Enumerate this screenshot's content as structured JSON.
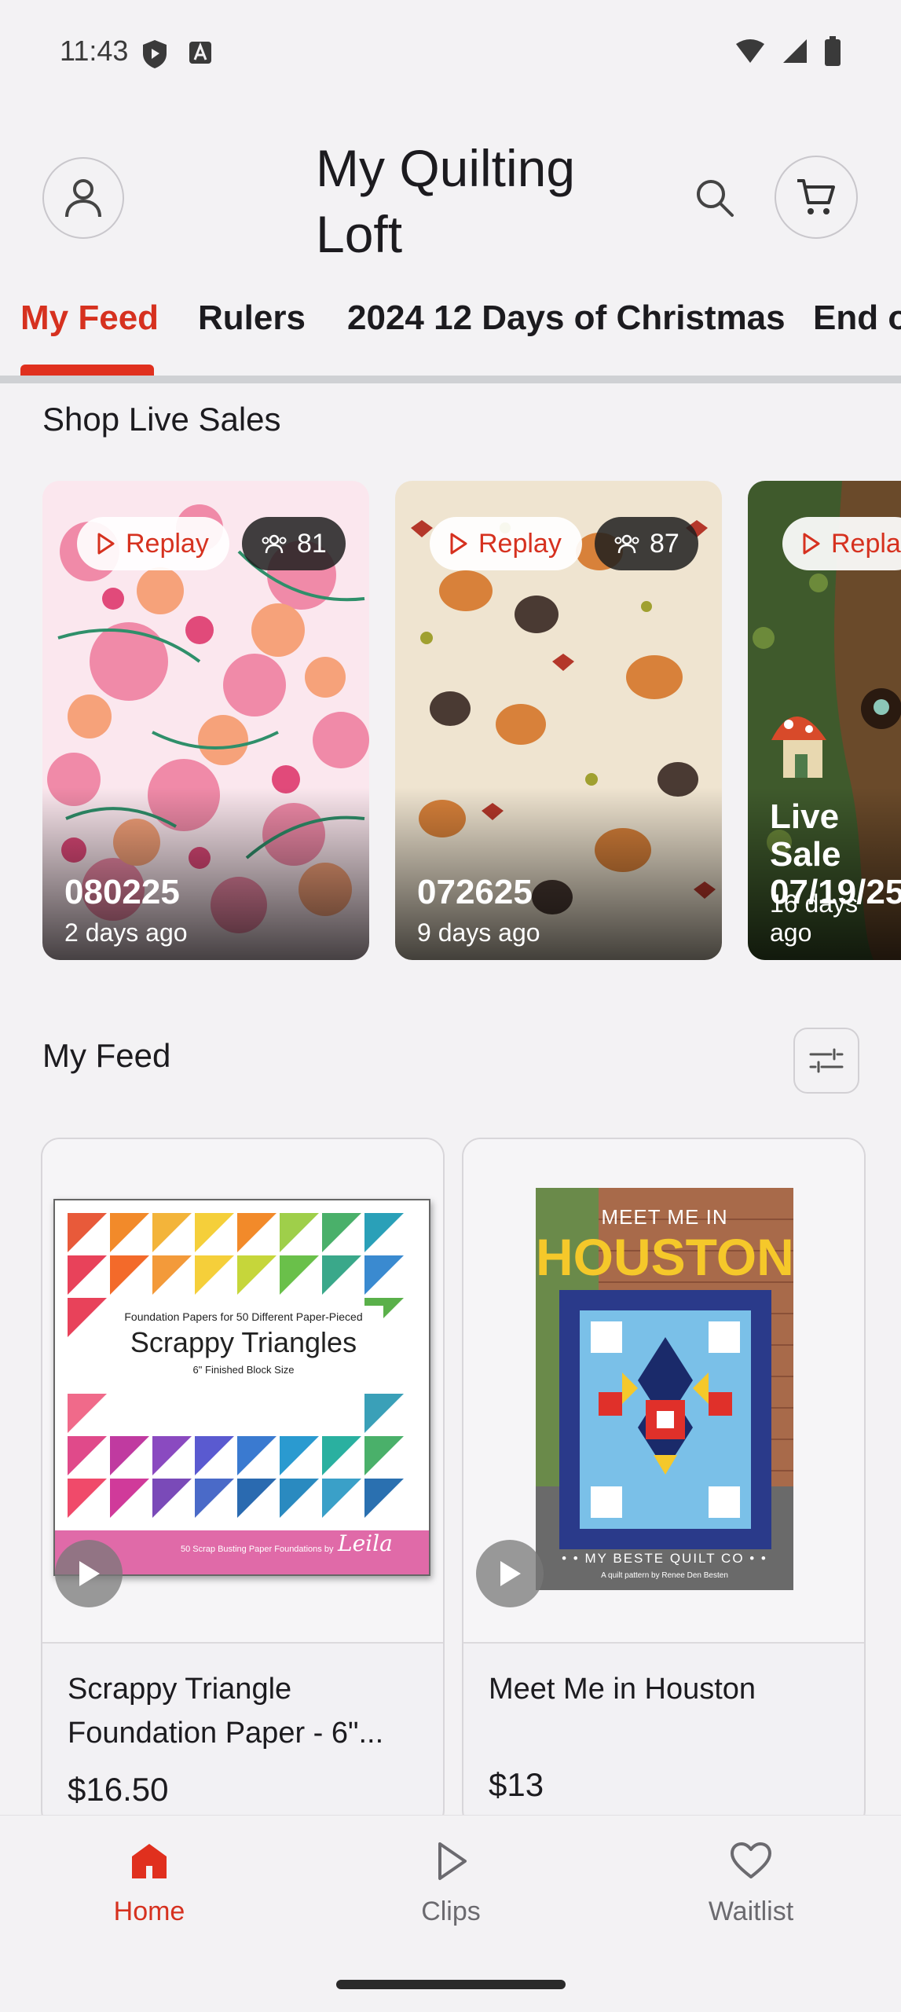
{
  "status_bar": {
    "time": "11:43"
  },
  "header": {
    "title": "My Quilting Loft"
  },
  "tabs": [
    {
      "label": "My Feed",
      "active": true
    },
    {
      "label": "Rulers",
      "active": false
    },
    {
      "label": "2024 12 Days of Christmas",
      "active": false
    },
    {
      "label": "End o",
      "active": false
    }
  ],
  "live_sales": {
    "title": "Shop Live Sales",
    "cards": [
      {
        "badge": "Replay",
        "viewers": "81",
        "title": "080225",
        "subtitle": "2 days ago"
      },
      {
        "badge": "Replay",
        "viewers": "87",
        "title": "072625",
        "subtitle": "9 days ago"
      },
      {
        "badge": "Repla",
        "viewers": "",
        "title": "Live Sale\n07/19/25",
        "title_line1": "Live Sale",
        "title_line2": "07/19/25",
        "subtitle": "16 days ago"
      }
    ]
  },
  "feed": {
    "title": "My Feed",
    "products": [
      {
        "name": "Scrappy Triangle Foundation Paper - 6\"...",
        "price": "$16.50",
        "cover": {
          "top_line": "Foundation Papers for 50 Different Paper-Pieced",
          "big_title": "Scrappy Triangles",
          "sub_line": "6\" Finished Block Size",
          "footer": "50 Scrap Busting Paper Foundations by",
          "signature": "Leila"
        }
      },
      {
        "name": "Meet Me in Houston",
        "price": "$13",
        "cover": {
          "top_line": "MEET ME IN",
          "big_title": "HOUSTON",
          "footer": "• • MY BESTE QUILT CO • •",
          "sub_line": "A quilt pattern by Renee Den Besten"
        }
      }
    ]
  },
  "bottom_nav": [
    {
      "label": "Home",
      "active": true
    },
    {
      "label": "Clips",
      "active": false
    },
    {
      "label": "Waitlist",
      "active": false
    }
  ],
  "colors": {
    "accent": "#e0301e",
    "background": "#f3f2f4"
  }
}
